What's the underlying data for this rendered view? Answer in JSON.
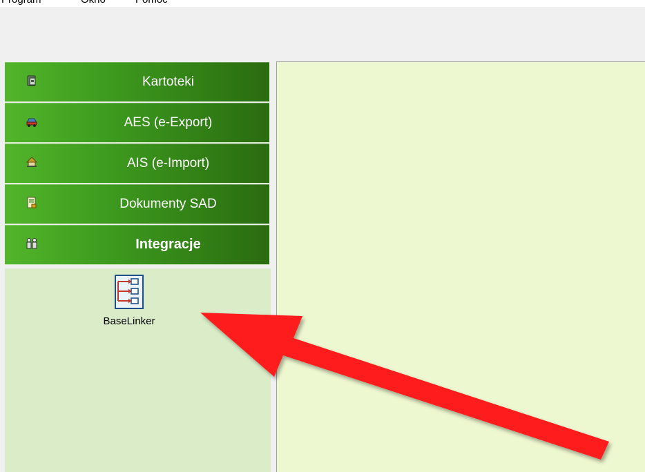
{
  "menu": {
    "items": [
      "Program",
      "Okno",
      "Pomoc"
    ]
  },
  "sidebar": {
    "items": [
      {
        "label": "Kartoteki",
        "icon": "folder-card-icon"
      },
      {
        "label": "AES (e-Export)",
        "icon": "export-car-icon"
      },
      {
        "label": "AIS (e-Import)",
        "icon": "import-house-icon"
      },
      {
        "label": "Dokumenty SAD",
        "icon": "document-sad-icon"
      },
      {
        "label": "Integracje",
        "icon": "integration-people-icon",
        "active": true
      }
    ],
    "panel": {
      "items": [
        {
          "label": "BaseLinker",
          "icon": "baselinker-icon"
        }
      ]
    }
  },
  "colors": {
    "nav_green_light": "#52b52a",
    "nav_green_dark": "#2a6b10",
    "panel_bg": "#daecc8",
    "content_bg": "#eef8d0",
    "arrow": "#ff1a1a"
  }
}
